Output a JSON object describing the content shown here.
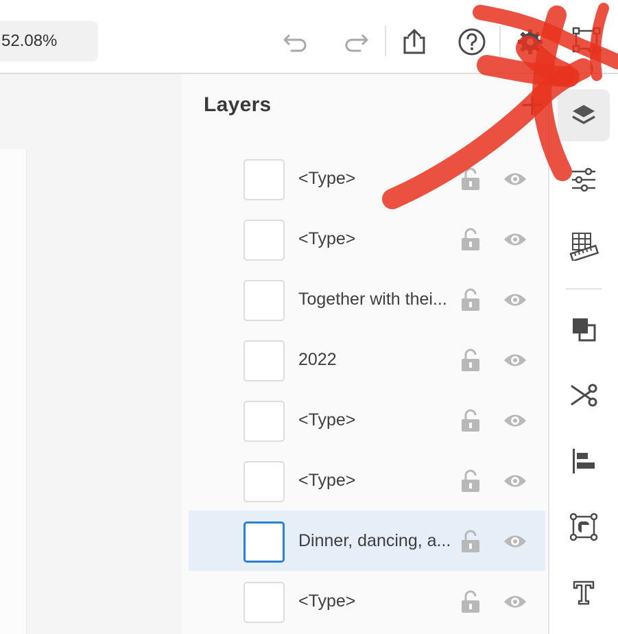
{
  "toolbar": {
    "zoom_value": "52.08%",
    "icons": [
      "undo-icon",
      "redo-icon",
      "share-icon",
      "help-icon",
      "settings-icon",
      "preview-icon"
    ]
  },
  "layers_panel": {
    "title": "Layers",
    "items": [
      {
        "label": "<Type>",
        "selected": false
      },
      {
        "label": "<Type>",
        "selected": false
      },
      {
        "label": "Together with thei...",
        "selected": false
      },
      {
        "label": "2022",
        "selected": false
      },
      {
        "label": "<Type>",
        "selected": false
      },
      {
        "label": "<Type>",
        "selected": false
      },
      {
        "label": "Dinner, dancing, a...",
        "selected": true
      },
      {
        "label": "<Type>",
        "selected": false
      }
    ]
  },
  "right_rail": {
    "icons": [
      "layers-icon",
      "properties-icon",
      "grid-ruler-icon",
      "arrange-icon",
      "cut-icon",
      "align-icon",
      "transform-icon",
      "type-icon"
    ],
    "active": "layers-icon"
  },
  "colors": {
    "selection_bg": "#e6eef8",
    "selection_border": "#2d7fd3",
    "scribble": "#e8321e"
  }
}
